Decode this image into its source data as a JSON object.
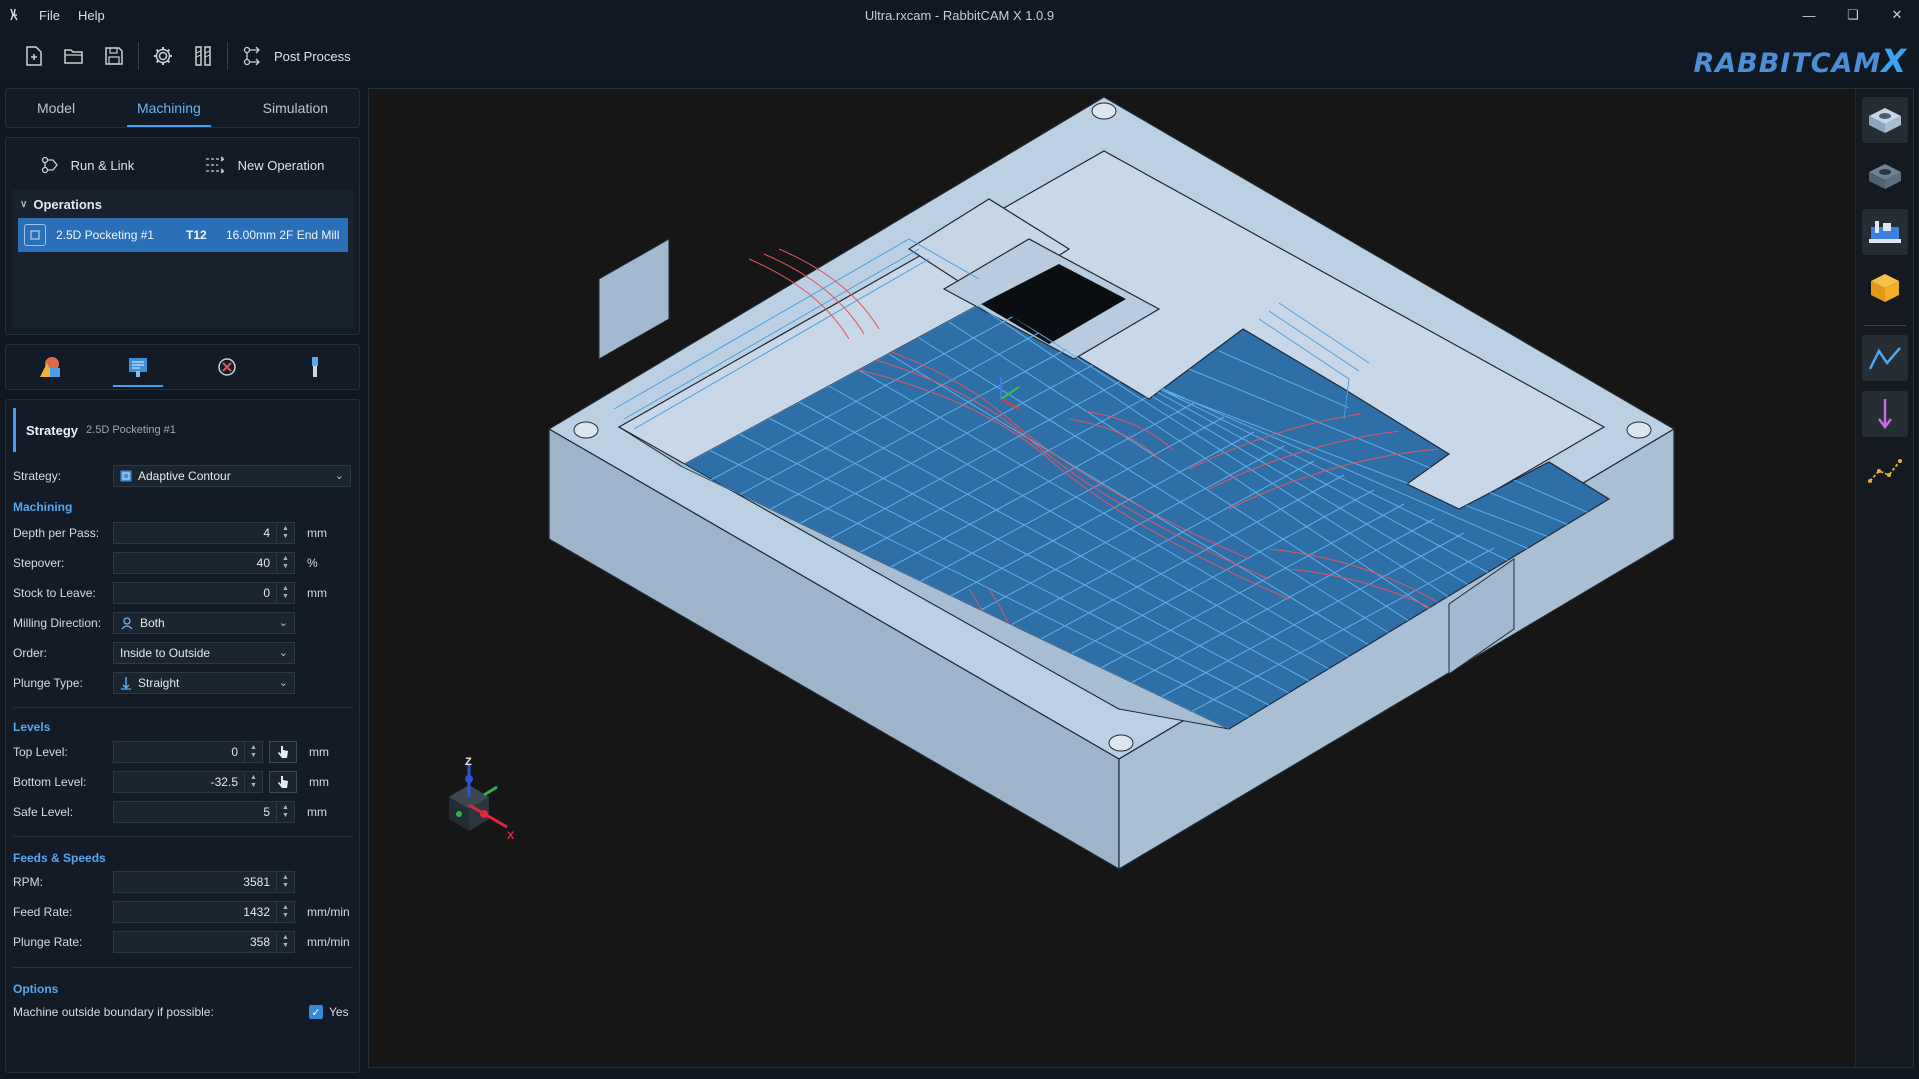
{
  "window": {
    "title": "Ultra.rxcam - RabbitCAM X 1.0.9",
    "menu": [
      "File",
      "Help"
    ]
  },
  "toolbar": {
    "post_process_label": "Post Process"
  },
  "logo": {
    "main": "RABBITCAM",
    "suffix": "X"
  },
  "tabs": [
    "Model",
    "Machining",
    "Simulation"
  ],
  "operations": {
    "run_link_label": "Run & Link",
    "new_operation_label": "New Operation",
    "header": "Operations",
    "items": [
      {
        "name": "2.5D Pocketing #1",
        "tool": "T12",
        "tool_desc": "16.00mm 2F End Mill"
      }
    ]
  },
  "strategy_panel": {
    "title": "Strategy",
    "subtitle": "2.5D Pocketing #1",
    "strategy_label": "Strategy:",
    "strategy_value": "Adaptive Contour",
    "machining": {
      "header": "Machining",
      "depth_label": "Depth per Pass:",
      "depth_value": "4",
      "depth_unit": "mm",
      "stepover_label": "Stepover:",
      "stepover_value": "40",
      "stepover_unit": "%",
      "stock_label": "Stock to Leave:",
      "stock_value": "0",
      "stock_unit": "mm",
      "direction_label": "Milling Direction:",
      "direction_value": "Both",
      "order_label": "Order:",
      "order_value": "Inside to Outside",
      "plunge_label": "Plunge Type:",
      "plunge_value": "Straight"
    },
    "levels": {
      "header": "Levels",
      "top_label": "Top Level:",
      "top_value": "0",
      "top_unit": "mm",
      "bottom_label": "Bottom Level:",
      "bottom_value": "-32.5",
      "bottom_unit": "mm",
      "safe_label": "Safe Level:",
      "safe_value": "5",
      "safe_unit": "mm"
    },
    "feeds": {
      "header": "Feeds & Speeds",
      "rpm_label": "RPM:",
      "rpm_value": "3581",
      "feed_label": "Feed Rate:",
      "feed_value": "1432",
      "feed_unit": "mm/min",
      "plunge_rate_label": "Plunge Rate:",
      "plunge_rate_value": "358",
      "plunge_rate_unit": "mm/min"
    },
    "options": {
      "header": "Options",
      "outside_label": "Machine outside boundary if possible:",
      "outside_value": "Yes",
      "outside_checked": true
    }
  },
  "gizmo": {
    "z": "Z",
    "x": "X"
  },
  "colors": {
    "accent": "#4a9df0",
    "selection": "#2a6fb8",
    "toolpath_cut": "#3d95d6",
    "toolpath_link": "#e2545f",
    "part": "#b3c8dd"
  }
}
